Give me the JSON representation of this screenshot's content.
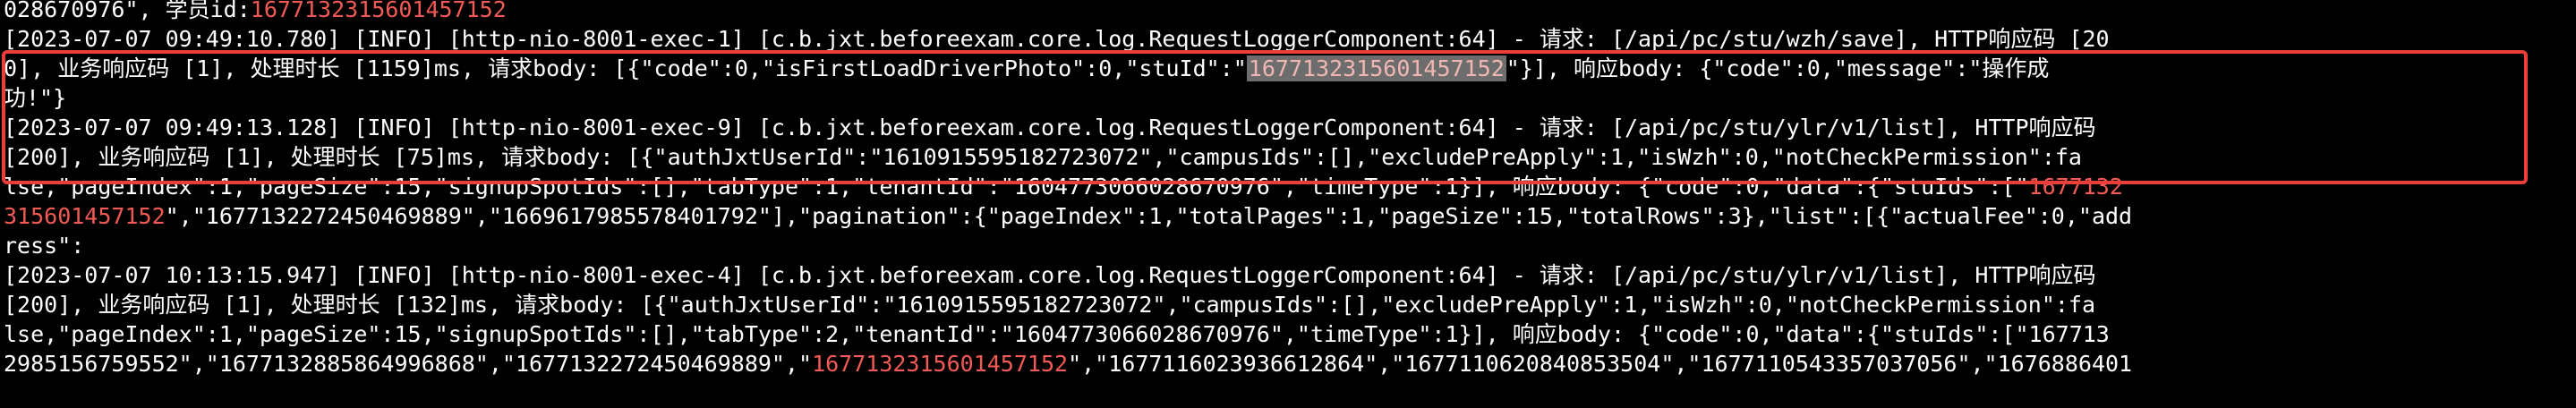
{
  "colors": {
    "background": "#000000",
    "text": "#ffffff",
    "highlight_text": "#f35a55",
    "selection_bg": "#6d6d6d",
    "annotation_box": "#e93f38"
  },
  "lines": [
    {
      "segments": [
        {
          "text": "028670976\", 学员id:",
          "style": "normal"
        },
        {
          "text": "1677132315601457152",
          "style": "highlight"
        }
      ]
    },
    {
      "segments": [
        {
          "text": "[2023-07-07 09:49:10.780] [INFO] [http-nio-8001-exec-1] [c.b.jxt.beforeexam.core.log.RequestLoggerComponent:64] - 请求: [/api/pc/stu/wzh/save], HTTP响应码 [20",
          "style": "normal"
        }
      ]
    },
    {
      "segments": [
        {
          "text": "0], 业务响应码 [1], 处理时长 [1159]ms, 请求body: [{\"code\":0,\"isFirstLoadDriverPhoto\":0,\"stuId\":\"",
          "style": "normal"
        },
        {
          "text": "1677132315601457152",
          "style": "selected"
        },
        {
          "text": "\"}], 响应body: {\"code\":0,\"message\":\"操作成",
          "style": "normal"
        }
      ]
    },
    {
      "segments": [
        {
          "text": "功!\"}",
          "style": "normal"
        }
      ]
    },
    {
      "segments": [
        {
          "text": "[2023-07-07 09:49:13.128] [INFO] [http-nio-8001-exec-9] [c.b.jxt.beforeexam.core.log.RequestLoggerComponent:64] - 请求: [/api/pc/stu/ylr/v1/list], HTTP响应码",
          "style": "normal"
        }
      ]
    },
    {
      "segments": [
        {
          "text": "[200], 业务响应码 [1], 处理时长 [75]ms, 请求body: [{\"authJxtUserId\":\"1610915595182723072\",\"campusIds\":[],\"excludePreApply\":1,\"isWzh\":0,\"notCheckPermission\":fa",
          "style": "normal"
        }
      ]
    },
    {
      "segments": [
        {
          "text": "lse,\"pageIndex\":1,\"pageSize\":15,\"signupSpotIds\":[],\"tabType\":1,\"tenantId\":\"1604773066028670976\",\"timeType\":1}], 响应body: {\"code\":0,\"data\":{\"stuIds\":[\"",
          "style": "normal"
        },
        {
          "text": "1677132",
          "style": "highlight"
        }
      ]
    },
    {
      "segments": [
        {
          "text": "315601457152",
          "style": "highlight"
        },
        {
          "text": "\",\"1677132272450469889\",\"1669617985578401792\"],\"pagination\":{\"pageIndex\":1,\"totalPages\":1,\"pageSize\":15,\"totalRows\":3},\"list\":[{\"actualFee\":0,\"add",
          "style": "normal"
        }
      ]
    },
    {
      "segments": [
        {
          "text": "ress\":",
          "style": "normal"
        }
      ]
    },
    {
      "segments": [
        {
          "text": "[2023-07-07 10:13:15.947] [INFO] [http-nio-8001-exec-4] [c.b.jxt.beforeexam.core.log.RequestLoggerComponent:64] - 请求: [/api/pc/stu/ylr/v1/list], HTTP响应码",
          "style": "normal"
        }
      ]
    },
    {
      "segments": [
        {
          "text": "[200], 业务响应码 [1], 处理时长 [132]ms, 请求body: [{\"authJxtUserId\":\"1610915595182723072\",\"campusIds\":[],\"excludePreApply\":1,\"isWzh\":0,\"notCheckPermission\":fa",
          "style": "normal"
        }
      ]
    },
    {
      "segments": [
        {
          "text": "lse,\"pageIndex\":1,\"pageSize\":15,\"signupSpotIds\":[],\"tabType\":2,\"tenantId\":\"1604773066028670976\",\"timeType\":1}], 响应body: {\"code\":0,\"data\":{\"stuIds\":[\"167713",
          "style": "normal"
        }
      ]
    },
    {
      "segments": [
        {
          "text": "2985156759552\",\"1677132885864996868\",\"1677132272450469889\",\"",
          "style": "normal"
        },
        {
          "text": "1677132315601457152",
          "style": "highlight"
        },
        {
          "text": "\",\"1677116023936612864\",\"1677110620840853504\",\"1677110543357037056\",\"1676886401",
          "style": "normal"
        }
      ]
    }
  ]
}
